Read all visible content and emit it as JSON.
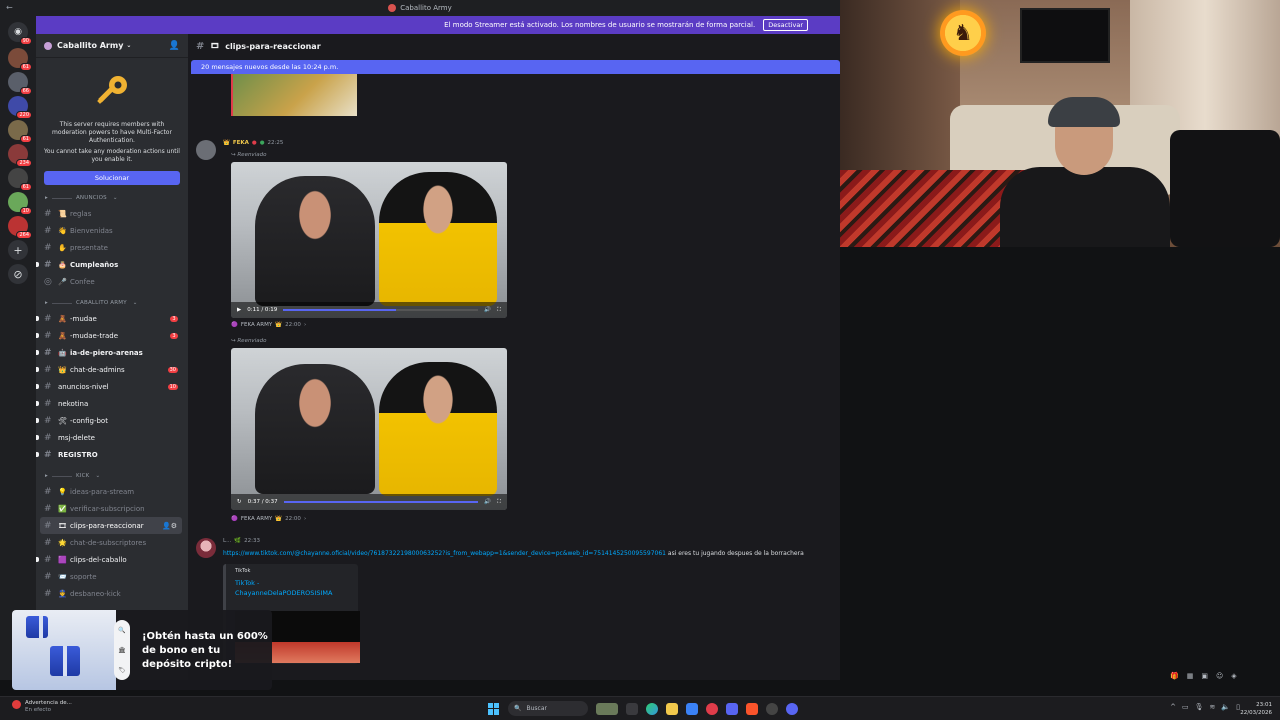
{
  "window": {
    "title": "Caballito Army"
  },
  "streamer_banner": {
    "text": "El modo Streamer está activado. Los nombres de usuario se mostrarán de forma parcial.",
    "button": "Desactivar"
  },
  "rail": {
    "badges": [
      "90",
      "61",
      "66",
      "220",
      "61",
      "234",
      "61",
      "10",
      "264"
    ]
  },
  "sidebar": {
    "server_name": "Caballito Army",
    "mfa_text": "This server requires members with moderation powers to have Multi-Factor Authentication.",
    "mfa_text2": "You cannot take any moderation actions until you enable it.",
    "resolve_button": "Solucionar",
    "categories": [
      "ANUNCIOS",
      "CABALLITO ARMY",
      "KICK"
    ],
    "anuncios": [
      {
        "emoji": "📜",
        "label": "reglas"
      },
      {
        "emoji": "👋",
        "label": "Bienvenidas"
      },
      {
        "emoji": "✋",
        "label": "presentate"
      },
      {
        "emoji": "🎂",
        "label": "Cumpleaños"
      },
      {
        "emoji": "🎤",
        "label": "Confee"
      }
    ],
    "army": [
      {
        "emoji": "🧸",
        "label": "-mudae",
        "mention": "3"
      },
      {
        "emoji": "🧸",
        "label": "-mudae-trade",
        "mention": "3"
      },
      {
        "emoji": "🤖",
        "label": "ia-de-piero-arenas"
      },
      {
        "emoji": "👑",
        "label": "chat-de-admins",
        "mention": "30"
      },
      {
        "emoji": "",
        "label": "anuncios-nivel",
        "mention": "10"
      },
      {
        "emoji": "",
        "label": "nekotina"
      },
      {
        "emoji": "🛠",
        "label": "-config-bot"
      },
      {
        "emoji": "",
        "label": "msj-delete"
      },
      {
        "emoji": "",
        "label": "REGISTRO"
      }
    ],
    "kick": [
      {
        "emoji": "💡",
        "label": "ideas-para-stream"
      },
      {
        "emoji": "✅",
        "label": "verificar-subscripcion"
      },
      {
        "emoji": "🎞",
        "label": "clips-para-reaccionar"
      },
      {
        "emoji": "🌟",
        "label": "chat-de-subscriptores"
      },
      {
        "emoji": "🟪",
        "label": "clips-del-caballo"
      },
      {
        "emoji": "📨",
        "label": "soporte"
      },
      {
        "emoji": "👮",
        "label": "desbaneo-kick"
      }
    ]
  },
  "main": {
    "channel_name": "clips-para-reaccionar",
    "new_messages": "20 mensajes nuevos desde las 10:24 p.m.",
    "msg1": {
      "name": "FEKA",
      "time": "22:25",
      "forwarded": "Reenviado"
    },
    "video1": {
      "time": "0:11 / 0:19",
      "progress": 0.58
    },
    "msg1_footer": {
      "name": "FEKA ARMY",
      "time": "22:00"
    },
    "forwarded2": "Reenviado",
    "video2": {
      "time": "0:37 / 0:37",
      "progress": 1.0
    },
    "msg2_footer": {
      "name": "FEKA ARMY",
      "time": "22:00"
    },
    "msg3": {
      "time": "22:33",
      "link": "https://www.tiktok.com/@chayanne.oficial/video/7618732219800063252?is_from_webapp=1&sender_device=pc&web_id=7514145250095597061",
      "text": "asi eres tu jugando despues de la borrachera"
    },
    "embed": {
      "provider": "TikTok",
      "title1": "TikTok -",
      "title2": "ChayanneDelaPODEROSISIMA"
    }
  },
  "promo": {
    "text": "¡Obtén hasta un 600% de bono en tu depósito cripto!"
  },
  "taskbar": {
    "warning_title": "Advertencia de...",
    "warning_sub": "En efecto",
    "search": "Buscar",
    "time": "23:01",
    "date": "22/03/2026"
  }
}
